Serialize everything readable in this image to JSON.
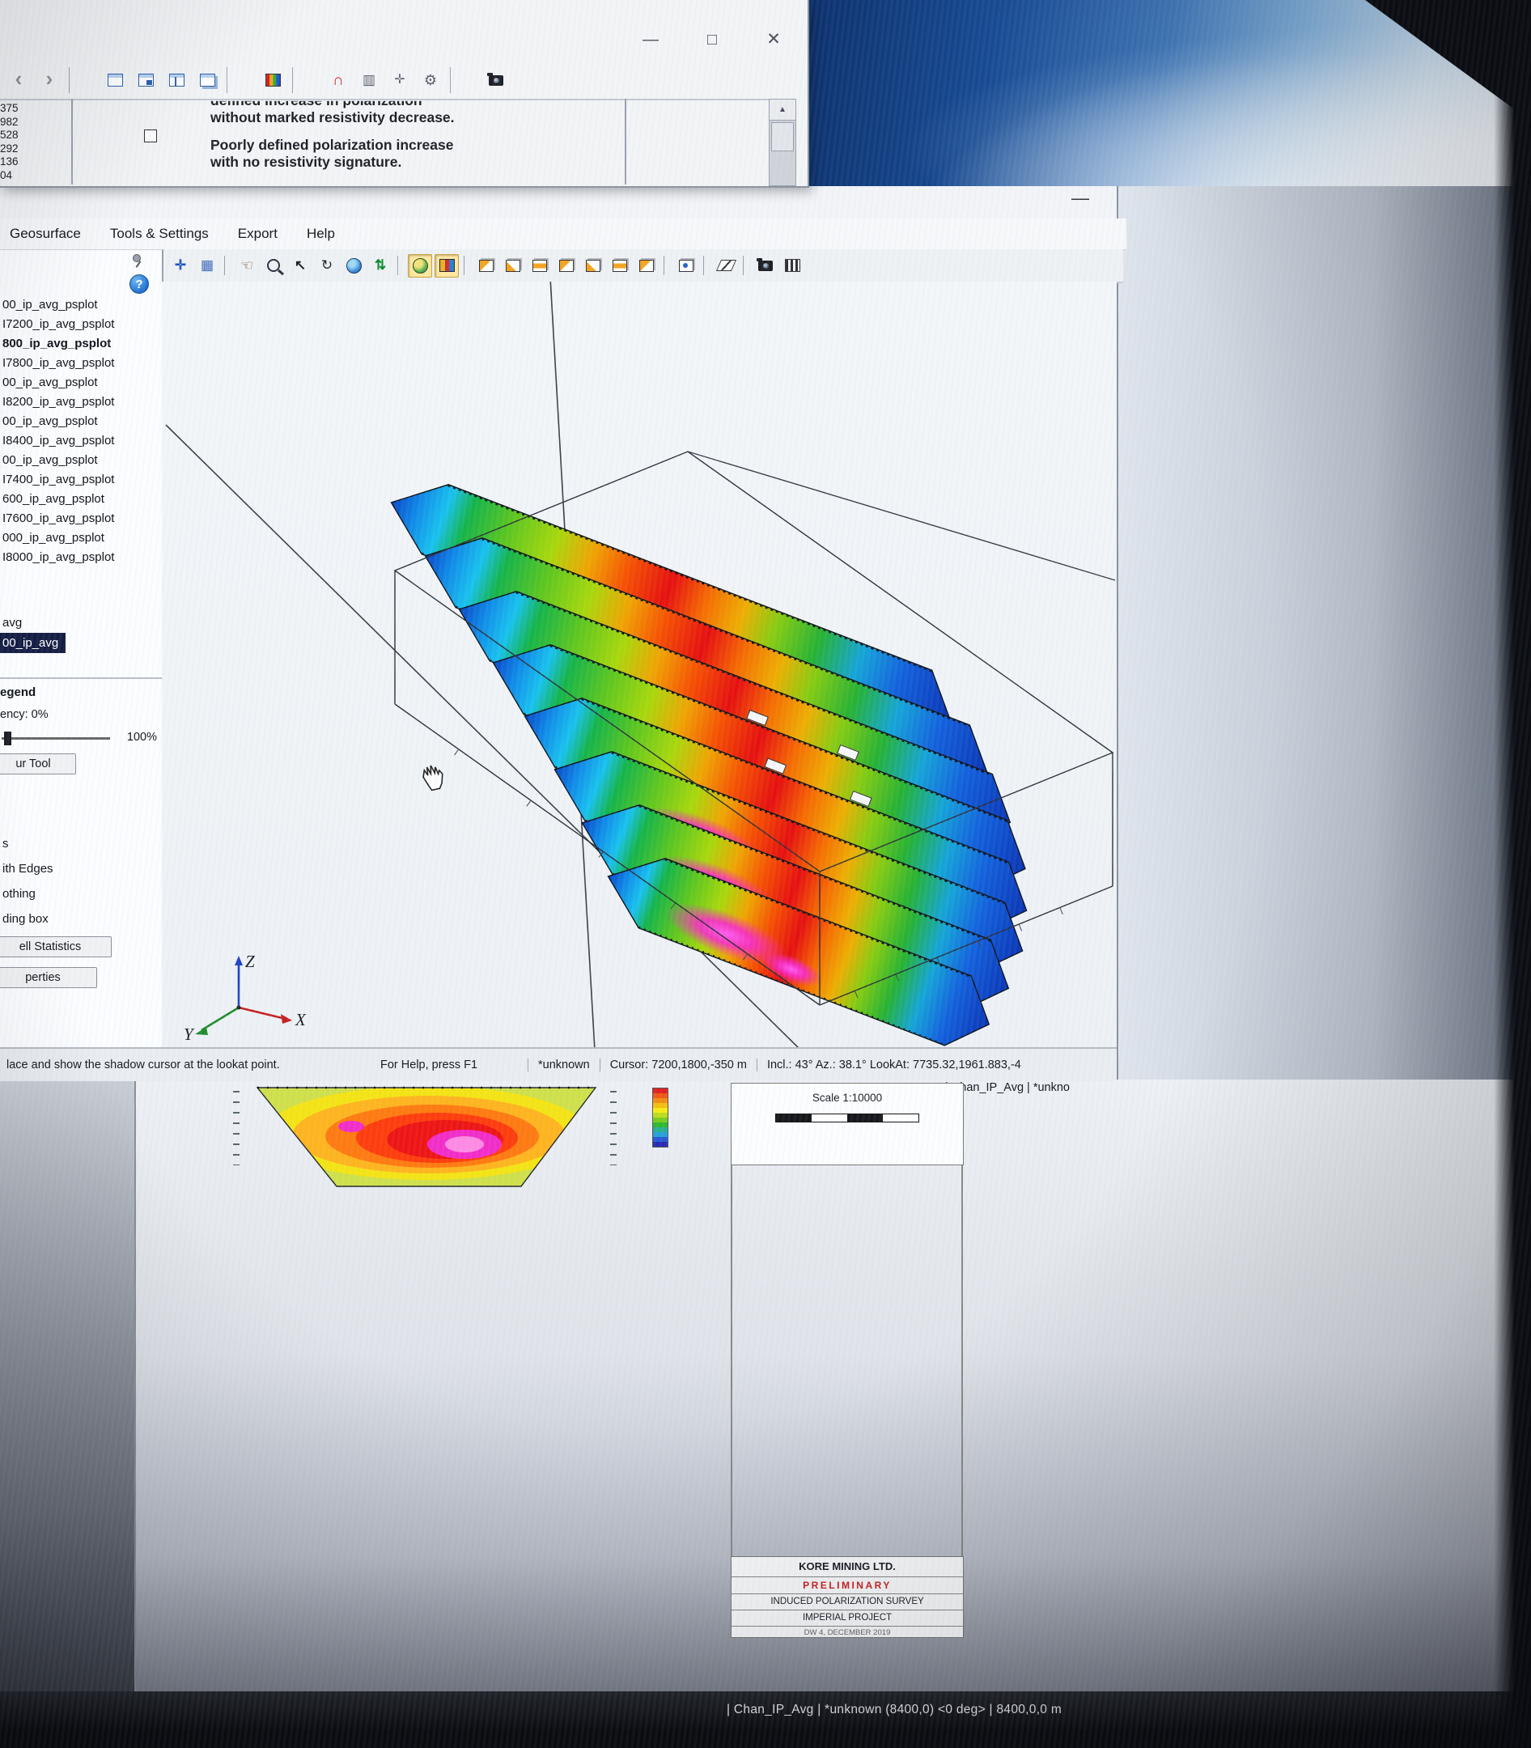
{
  "win_top": {
    "minimize": "—",
    "maximize": "□",
    "close": "✕",
    "numbers": [
      "375",
      "982",
      "528",
      "292",
      "136",
      "04"
    ],
    "para1_cut": "defined increase in polarization",
    "para1": "without marked resistivity decrease.",
    "para2a": "Poorly defined polarization increase",
    "para2b": "with no resistivity signature.",
    "scroll_up": "▲",
    "toolbar": [
      {
        "name": "nav-back-icon",
        "kind": "chevL"
      },
      {
        "name": "nav-forward-icon",
        "kind": "chevR"
      },
      {
        "name": "toolbar-separator",
        "kind": "sep"
      },
      {
        "name": "window-map-icon",
        "kind": "win1"
      },
      {
        "name": "window-new-icon",
        "kind": "win2"
      },
      {
        "name": "window-tile-icon",
        "kind": "win3"
      },
      {
        "name": "window-cascade-icon",
        "kind": "win4"
      },
      {
        "name": "toolbar-separator",
        "kind": "sep"
      },
      {
        "name": "color-legend-icon",
        "kind": "colorbar"
      },
      {
        "name": "toolbar-separator",
        "kind": "sep"
      },
      {
        "name": "magnet-snap-icon",
        "kind": "magnet"
      },
      {
        "name": "grid-lines-icon",
        "kind": "grid2"
      },
      {
        "name": "add-marker-icon",
        "kind": "plus"
      },
      {
        "name": "settings-gear-icon",
        "kind": "gear"
      },
      {
        "name": "toolbar-separator",
        "kind": "sep"
      },
      {
        "name": "snapshot-camera-icon",
        "kind": "camera"
      }
    ]
  },
  "app": {
    "minimize": "—",
    "menu": [
      {
        "label": "Geosurface"
      },
      {
        "label": "Tools & Settings"
      },
      {
        "label": "Export"
      },
      {
        "label": "Help"
      }
    ],
    "toolbar": [
      {
        "name": "shadow-cursor-icon",
        "kind": "move"
      },
      {
        "name": "page-layout-icon",
        "kind": "grid"
      },
      {
        "name": "toolbar-separator",
        "kind": "sep"
      },
      {
        "name": "pan-hand-icon",
        "kind": "hand"
      },
      {
        "name": "zoom-icon",
        "kind": "zoom"
      },
      {
        "name": "select-marquee-icon",
        "kind": "select"
      },
      {
        "name": "select-lasso-icon",
        "kind": "lasso"
      },
      {
        "name": "globe-view-icon",
        "kind": "globe"
      },
      {
        "name": "zoom-extents-icon",
        "kind": "arrows"
      },
      {
        "name": "toolbar-separator",
        "kind": "sep"
      },
      {
        "name": "shaded-view-icon",
        "kind": "pressed-globe",
        "pressed": true
      },
      {
        "name": "texture-view-icon",
        "kind": "pressed-palette",
        "pressed": true
      },
      {
        "name": "toolbar-separator",
        "kind": "sep"
      },
      {
        "name": "voxel-box-icon",
        "kind": "cube1"
      },
      {
        "name": "voxel-slice-east-icon",
        "kind": "cube2"
      },
      {
        "name": "voxel-slice-north-icon",
        "kind": "cube3"
      },
      {
        "name": "voxel-slice-depth-icon",
        "kind": "cube1"
      },
      {
        "name": "voxel-chair-cut-icon",
        "kind": "cube2"
      },
      {
        "name": "voxel-shell-icon",
        "kind": "cube3"
      },
      {
        "name": "voxel-isosurface-icon",
        "kind": "cube1"
      },
      {
        "name": "toolbar-separator",
        "kind": "sep"
      },
      {
        "name": "orientation-cube-icon",
        "kind": "cube-orient"
      },
      {
        "name": "toolbar-separator",
        "kind": "sep"
      },
      {
        "name": "clip-plane-icon",
        "kind": "clip"
      },
      {
        "name": "toolbar-separator",
        "kind": "sep"
      },
      {
        "name": "snapshot-camera-icon",
        "kind": "camera"
      },
      {
        "name": "animation-film-icon",
        "kind": "film"
      }
    ],
    "panel": {
      "help_glyph": "?",
      "tree": [
        {
          "label": "00_ip_avg_psplot"
        },
        {
          "label": "I7200_ip_avg_psplot"
        },
        {
          "label": "800_ip_avg_psplot",
          "bold": true
        },
        {
          "label": "I7800_ip_avg_psplot"
        },
        {
          "label": "00_ip_avg_psplot"
        },
        {
          "label": "I8200_ip_avg_psplot"
        },
        {
          "label": "00_ip_avg_psplot"
        },
        {
          "label": "I8400_ip_avg_psplot"
        },
        {
          "label": "00_ip_avg_psplot"
        },
        {
          "label": "I7400_ip_avg_psplot"
        },
        {
          "label": "600_ip_avg_psplot"
        },
        {
          "label": "I7600_ip_avg_psplot"
        },
        {
          "label": "000_ip_avg_psplot"
        },
        {
          "label": "I8000_ip_avg_psplot"
        }
      ],
      "items2": [
        {
          "label": "avg"
        },
        {
          "label": "00_ip_avg",
          "selected": true
        }
      ],
      "legend": "egend",
      "transparency": "ency: 0%",
      "slider_max": "100%",
      "contour_btn": "ur Tool",
      "options": [
        {
          "label": "s"
        },
        {
          "label": "ith Edges"
        },
        {
          "label": "othing"
        },
        {
          "label": "ding box"
        }
      ],
      "stats_btn": "ell Statistics",
      "props_btn": "perties"
    },
    "axes": {
      "x": "X",
      "y": "Y",
      "z": "Z"
    },
    "status": {
      "hint": "lace and show the shadow cursor at the lookat point.",
      "help": "For Help, press F1",
      "dataset": "*unknown",
      "cursor": "Cursor: 7200,1800,-350 m",
      "view": "Incl.: 43° Az.: 38.1° LookAt: 7735.32,1961.883,-4",
      "side": "| Chan_IP_Avg   | *unkno"
    }
  },
  "map_window": {
    "scale_label": "Scale 1:10000",
    "colorbar_colors": [
      "#e02020",
      "#f05818",
      "#f08c10",
      "#f4be10",
      "#f4ec14",
      "#bcdc1c",
      "#78cc20",
      "#30b830",
      "#28b090",
      "#28a0d8",
      "#2858d8",
      "#2828b0"
    ],
    "title_block": {
      "company": "KORE MINING LTD.",
      "status": "PRELIMINARY",
      "line1": "INDUCED POLARIZATION SURVEY",
      "line2": "IMPERIAL PROJECT",
      "line3": "DW 4, DECEMBER 2019"
    },
    "bottom_status": "| Chan_IP_Avg   | *unknown (8400,0)  <0 deg>   | 8400,0,0 m"
  }
}
